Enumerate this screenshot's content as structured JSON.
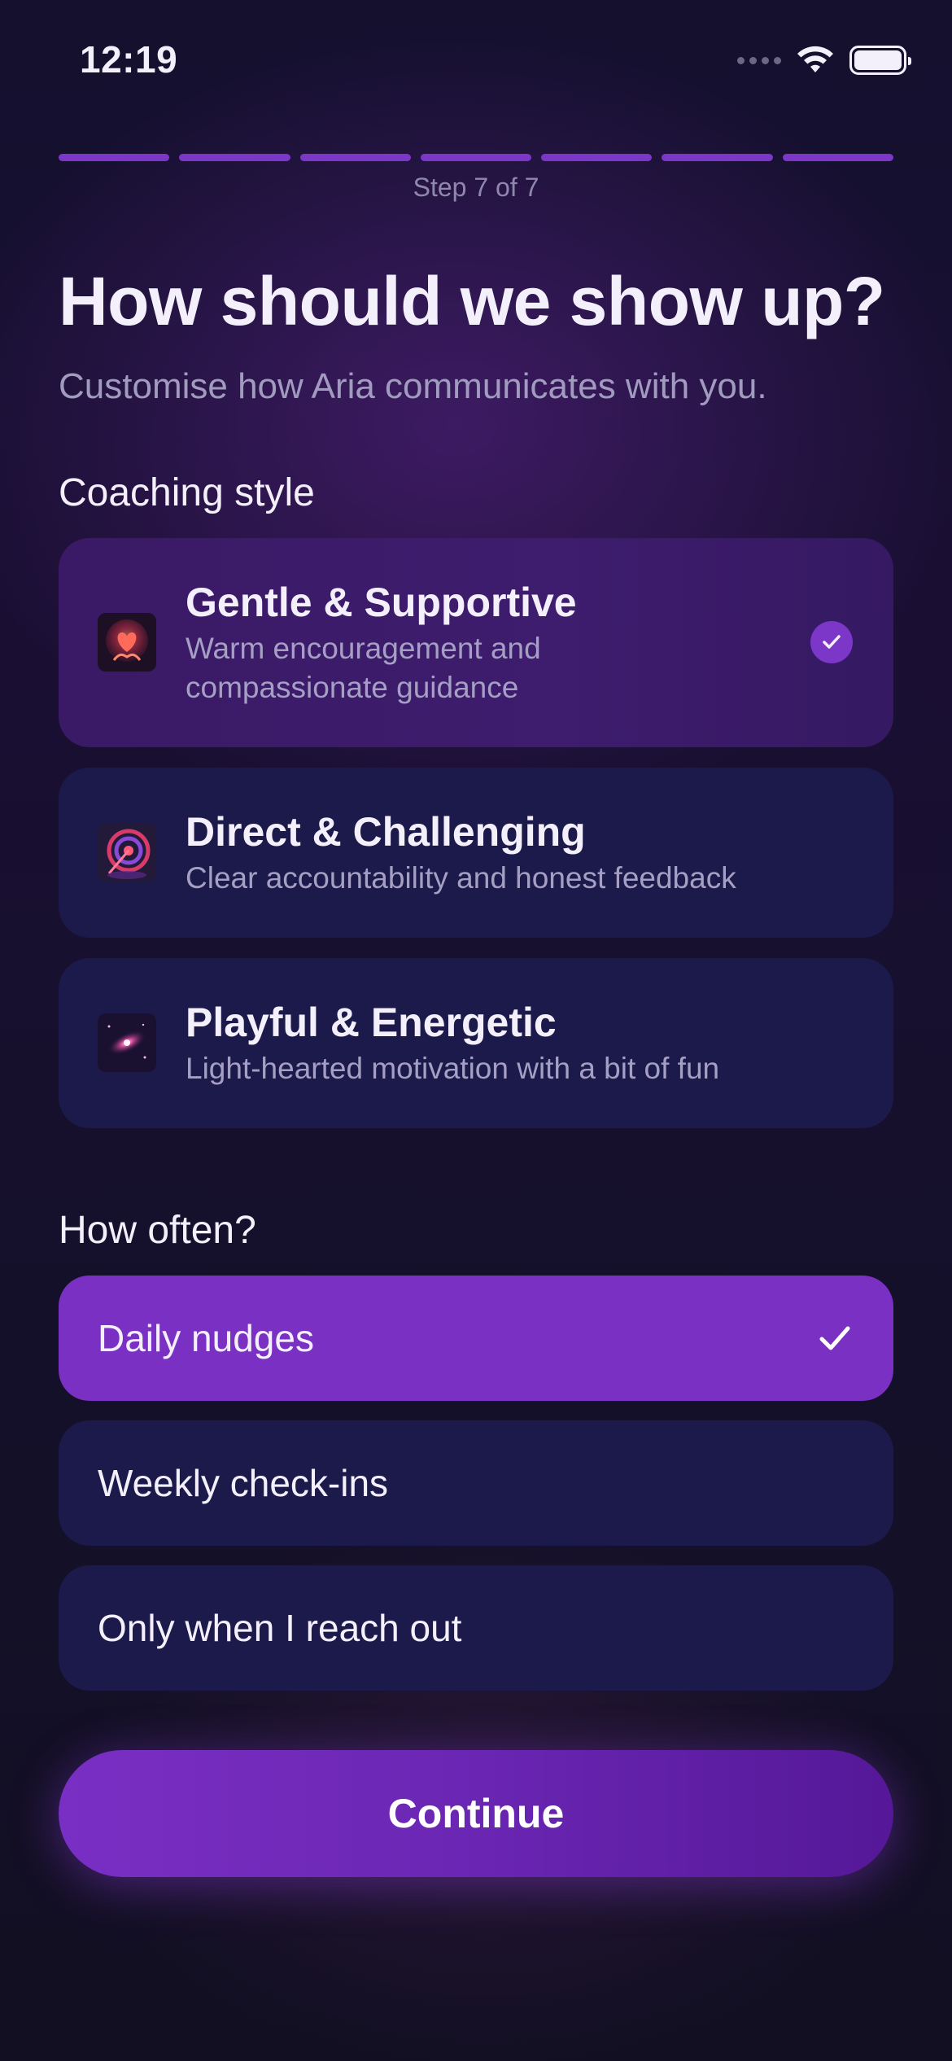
{
  "status_bar": {
    "time": "12:19"
  },
  "progress": {
    "current_step": 7,
    "total_steps": 7,
    "label": "Step 7 of 7"
  },
  "header": {
    "title": "How should we show up?",
    "subtitle": "Customise how Aria communicates with you."
  },
  "coaching_style": {
    "label": "Coaching style",
    "options": [
      {
        "name": "Gentle & Supportive",
        "description_line1": "Warm encouragement and",
        "description_line2": "compassionate guidance",
        "selected": true,
        "icon": "heart-hands-image"
      },
      {
        "name": "Direct & Challenging",
        "description_line1": "Clear accountability and honest feedback",
        "selected": false,
        "icon": "target-image"
      },
      {
        "name": "Playful & Energetic",
        "description_line1": "Light-hearted motivation with a bit of fun",
        "selected": false,
        "icon": "galaxy-image"
      }
    ]
  },
  "frequency": {
    "label": "How often?",
    "options": [
      {
        "label": "Daily nudges",
        "selected": true
      },
      {
        "label": "Weekly check-ins",
        "selected": false
      },
      {
        "label": "Only when I reach out",
        "selected": false
      }
    ]
  },
  "continue_label": "Continue",
  "colors": {
    "accent": "#7c36c8",
    "card": "#1c1a4a",
    "selected_option": "#7a30c2",
    "background": "#14102e"
  }
}
